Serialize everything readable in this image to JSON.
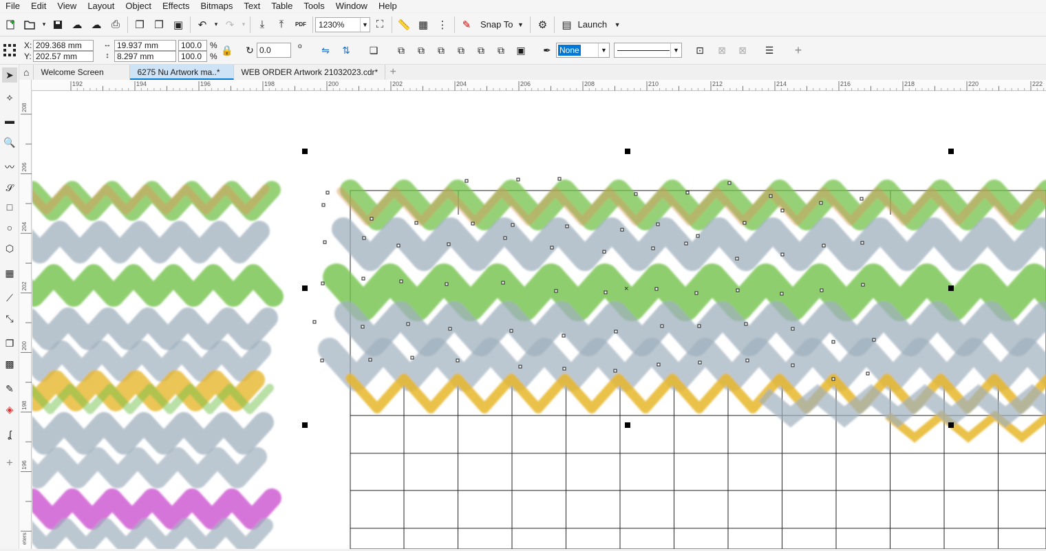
{
  "menu": [
    "File",
    "Edit",
    "View",
    "Layout",
    "Object",
    "Effects",
    "Bitmaps",
    "Text",
    "Table",
    "Tools",
    "Window",
    "Help"
  ],
  "toolbar": {
    "zoom": "1230%",
    "snap_to": "Snap To",
    "launch": "Launch",
    "pdf_label": "PDF"
  },
  "properties": {
    "x_label": "X:",
    "x_value": "209.368 mm",
    "y_label": "Y:",
    "y_value": "202.57 mm",
    "width_value": "19.937 mm",
    "height_value": "8.297 mm",
    "scale_w": "100.0",
    "scale_h": "100.0",
    "percent": "%",
    "rotation": "0.0",
    "degree": "o",
    "outline_width": "None"
  },
  "tabs": [
    "Welcome Screen",
    "6275 Nu Artwork ma..*",
    "WEB ORDER Artwork 21032023.cdr*"
  ],
  "ruler": {
    "h_ticks": [
      "192",
      "194",
      "196",
      "198",
      "200",
      "202",
      "204",
      "206",
      "208",
      "210",
      "212",
      "214",
      "216",
      "218",
      "220",
      "222"
    ],
    "v_ticks": [
      "208",
      "206",
      "204",
      "202",
      "200",
      "198",
      "196"
    ],
    "v_unit": "eters"
  },
  "colors": {
    "gray_wave": "#9fb0bd",
    "green_wave": "#73c24a",
    "yellow_wave": "#e6b72a",
    "magenta_wave": "#c848cc",
    "orange_wave": "#d99a5a",
    "selected_tab": "#cfe3f7",
    "accent": "#0078d7"
  }
}
